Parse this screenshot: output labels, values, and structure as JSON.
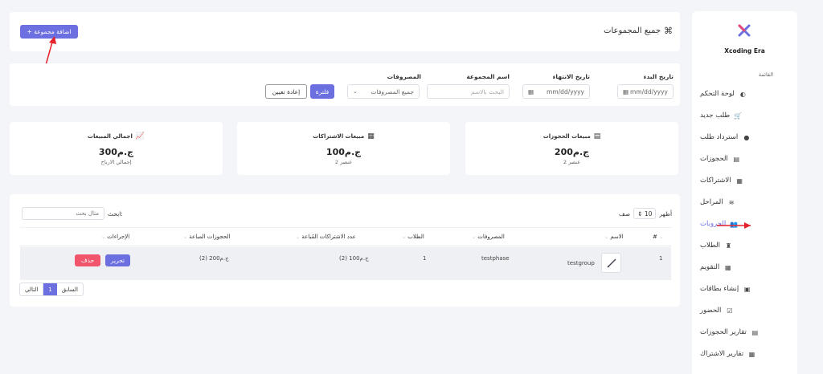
{
  "sidebar": {
    "brand": "Xcoding Era",
    "section": "القائمة",
    "items": [
      {
        "label": "لوحة التحكم",
        "icon": "dashboard-icon",
        "glyph": "◐"
      },
      {
        "label": "طلب جديد",
        "icon": "cart-icon",
        "glyph": "🛒"
      },
      {
        "label": "استرداد طلب",
        "icon": "return-icon",
        "glyph": "●"
      },
      {
        "label": "الحجوزات",
        "icon": "book-icon",
        "glyph": "▤"
      },
      {
        "label": "الاشتراكات",
        "icon": "calendar-icon",
        "glyph": "▦"
      },
      {
        "label": "المراحل",
        "icon": "layers-icon",
        "glyph": "≋"
      },
      {
        "label": "الجروبات",
        "icon": "users-icon",
        "glyph": "👥"
      },
      {
        "label": "الطلاب",
        "icon": "student-icon",
        "glyph": "♜"
      },
      {
        "label": "التقويم",
        "icon": "calendar-icon",
        "glyph": "▦"
      },
      {
        "label": "إنشاء بطاقات",
        "icon": "card-icon",
        "glyph": "▣"
      },
      {
        "label": "الحضور",
        "icon": "check-calendar-icon",
        "glyph": "☑"
      },
      {
        "label": "تقارير الحجوزات",
        "icon": "book-icon",
        "glyph": "▤"
      },
      {
        "label": "تقارير الاشتراك",
        "icon": "calendar-icon",
        "glyph": "▦"
      }
    ]
  },
  "header": {
    "title": "جميع المجموعات",
    "add_button": "+ اضافة مجموعة"
  },
  "filters": {
    "start_date_label": "تاريخ البدء",
    "end_date_label": "تاريخ الانتهاء",
    "group_name_label": "اسم المجموعة",
    "expenses_label": "المصروفات",
    "date_placeholder": "mm/dd/yyyy",
    "name_placeholder": "البحث بالاسم",
    "expenses_value": "جميع المصروفات",
    "filter_button": "فلترة",
    "reset_button": "إعادة تعيين"
  },
  "stats": [
    {
      "title": "مبيعات الحجوزات",
      "value": "ج.م200",
      "sub": "2 عنصر"
    },
    {
      "title": "مبيعات الاشتراكات",
      "value": "ج.م100",
      "sub": "2 عنصر"
    },
    {
      "title": "اجمالي المبيعات",
      "value": "ج.م300",
      "sub": "إجمالي الارباح"
    }
  ],
  "table": {
    "show_label": "أظهر",
    "entries_value": "10",
    "rows_label": "صف",
    "search_label": "ابحث:",
    "search_placeholder": "مثال بحث",
    "headers": [
      "#",
      "الاسم",
      "المصروفات",
      "الطلاب",
      "عدد الاشتراكات المُباعة",
      "الحجوزات المباعة",
      "الإجراءات"
    ],
    "rows": [
      {
        "num": "1",
        "name": "testgroup",
        "expense": "testphase",
        "students": "1",
        "subs": "ج.م100 (2)",
        "bookings": "ج.م200 (2)",
        "edit": "تحرير",
        "delete": "حذف"
      }
    ],
    "pagination": {
      "prev": "السابق",
      "page": "1",
      "next": "التالي"
    }
  },
  "colors": {
    "accent": "#6c6fe0",
    "danger": "#f1556c",
    "annotation": "#e5202a"
  }
}
